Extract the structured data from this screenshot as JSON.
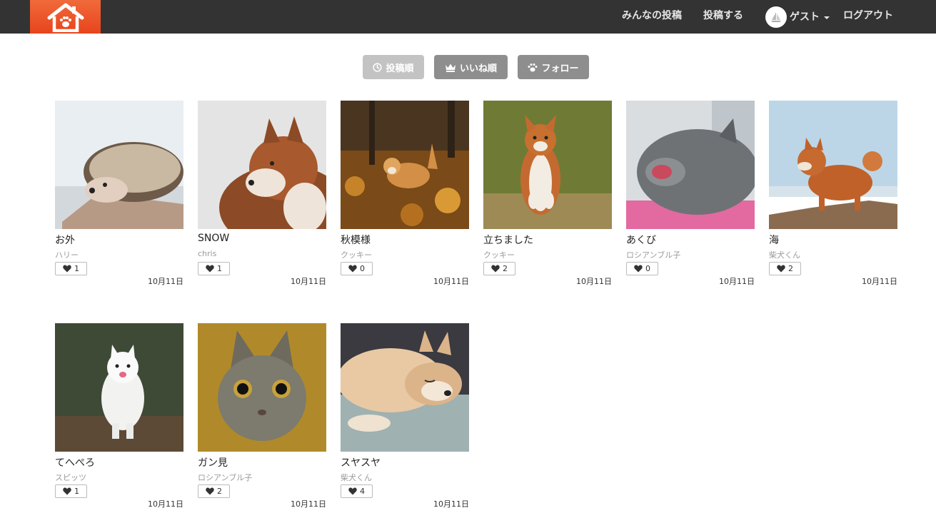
{
  "nav": {
    "all_posts": "みんなの投稿",
    "post": "投稿する",
    "user": "ゲスト",
    "logout": "ログアウト"
  },
  "sort": {
    "by_date": "投稿順",
    "by_likes": "いいね順",
    "follow": "フォロー"
  },
  "posts": [
    {
      "title": "お外",
      "author": "ハリー",
      "likes": "1",
      "date": "10月11日",
      "animal": "hedgehog"
    },
    {
      "title": "SNOW",
      "author": "chris",
      "likes": "1",
      "date": "10月11日",
      "animal": "husky"
    },
    {
      "title": "秋模様",
      "author": "クッキー",
      "likes": "0",
      "date": "10月11日",
      "animal": "corgi-leaves"
    },
    {
      "title": "立ちました",
      "author": "クッキー",
      "likes": "2",
      "date": "10月11日",
      "animal": "corgi-standing"
    },
    {
      "title": "あくび",
      "author": "ロシアンブル子",
      "likes": "0",
      "date": "10月11日",
      "animal": "cat-yawning"
    },
    {
      "title": "海",
      "author": "柴犬くん",
      "likes": "2",
      "date": "10月11日",
      "animal": "shiba-beach"
    },
    {
      "title": "てへぺろ",
      "author": "スピッツ",
      "likes": "1",
      "date": "10月11日",
      "animal": "spitz"
    },
    {
      "title": "ガン見",
      "author": "ロシアンブル子",
      "likes": "2",
      "date": "10月11日",
      "animal": "cat-staring"
    },
    {
      "title": "スヤスヤ",
      "author": "柴犬くん",
      "likes": "4",
      "date": "10月11日",
      "animal": "shiba-sleeping"
    }
  ]
}
